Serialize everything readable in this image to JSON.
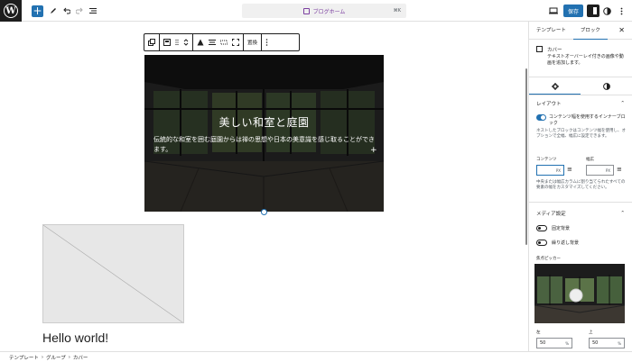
{
  "topbar": {
    "logo": "W",
    "add_label": "+",
    "doc_title": "ブログホーム",
    "shortcut": "⌘K",
    "save_label": "保存",
    "icons": [
      "wordpress-logo",
      "add-block",
      "pencil-tool",
      "undo",
      "redo",
      "list-view",
      "device-preview",
      "save",
      "settings-sidebar",
      "styles",
      "more-options"
    ]
  },
  "toolbar": {
    "replace_label": "置換"
  },
  "cover": {
    "title": "美しい和室と庭園",
    "text": "伝統的な和室を囲む庭園からは禅の思想や日本の美意識を感じ取ることができます。",
    "plus": "+"
  },
  "content": {
    "post_title": "Hello world!"
  },
  "sidebar": {
    "tabs": [
      "テンプレート",
      "ブロック"
    ],
    "active_tab": "ブロック",
    "block_title": "カバー",
    "block_desc": "テキストオーバーレイ付きの画像や動画を追加します。",
    "layout": {
      "heading": "レイアウト",
      "inner_toggle_label": "コンテンツ幅を使用するインナーブロック",
      "inner_toggle_help": "ネストしたブロックはコンテンツ幅を使用し、オプションで全幅、幅広に設定できます。",
      "content_label": "コンテンツ",
      "wide_label": "幅広",
      "content_value": "",
      "wide_value": "",
      "unit": "PX",
      "help": "中央または幅広カラムに割り当てられたすべての要素の幅をカスタマイズしてください。"
    },
    "media": {
      "heading": "メディア設定",
      "fixed_bg": "固定背景",
      "repeat_bg": "繰り返し背景",
      "focal_label": "焦点ピッカー",
      "left_label": "左",
      "top_label": "上",
      "left_value": "50",
      "top_value": "50",
      "percent": "%"
    }
  },
  "breadcrumb": [
    "テンプレート",
    "グループ",
    "カバー"
  ],
  "colors": {
    "accent": "#2271b1",
    "dark": "#1e1e1e",
    "template": "#7b3fa0"
  }
}
